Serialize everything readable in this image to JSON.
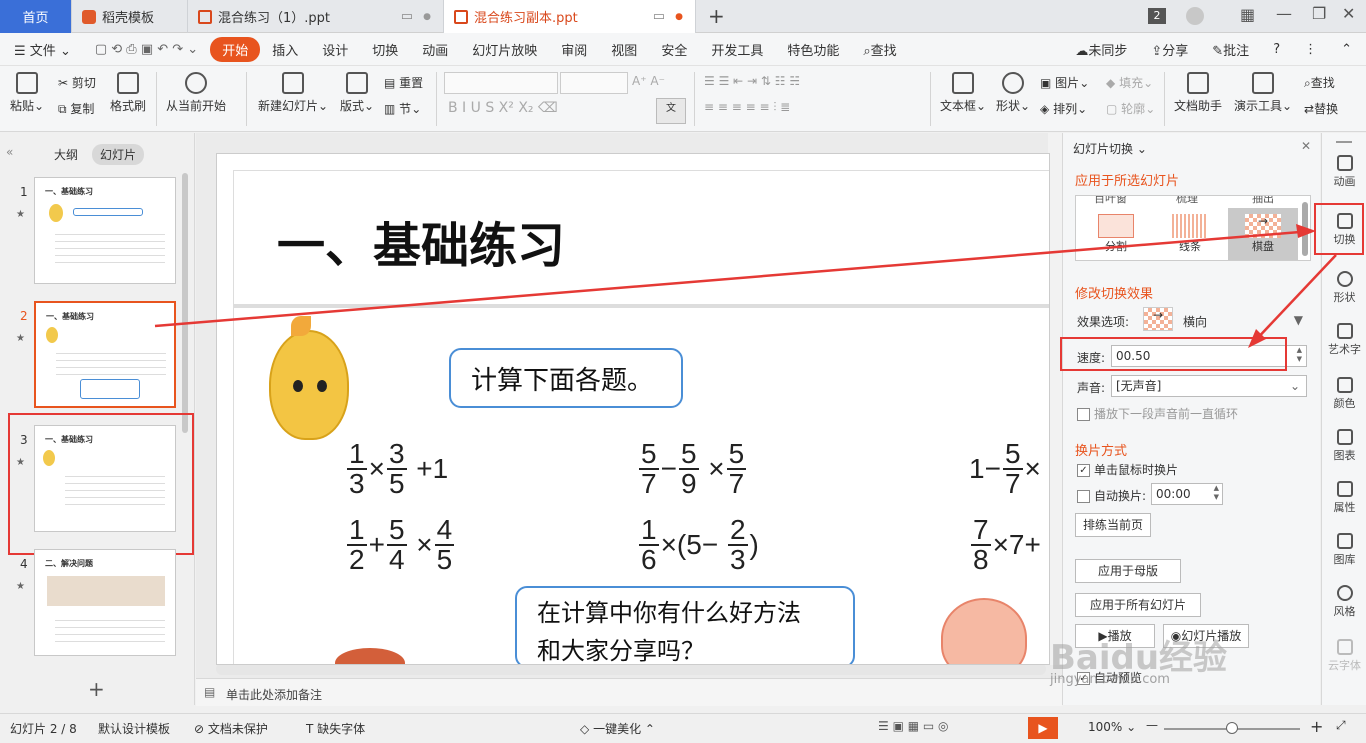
{
  "tabs": {
    "home": "首页",
    "daoke": "稻壳模板",
    "file1": "混合练习（1）.ppt",
    "file2": "混合练习副本.ppt",
    "count": "2"
  },
  "menu": {
    "file": "文件",
    "start": "开始",
    "insert": "插入",
    "design": "设计",
    "transition": "切换",
    "animation": "动画",
    "slideshow": "幻灯片放映",
    "review": "审阅",
    "view": "视图",
    "security": "安全",
    "dev": "开发工具",
    "special": "特色功能",
    "search": "查找",
    "unsync": "未同步",
    "share": "分享",
    "comment": "批注"
  },
  "ribbon": {
    "paste": "粘贴",
    "cut": "剪切",
    "copy": "复制",
    "format_brush": "格式刷",
    "from_start": "从当前开始",
    "new_slide": "新建幻灯片",
    "layout": "版式",
    "reset": "重置",
    "section": "节",
    "textbox": "文本框",
    "shape": "形状",
    "picture": "图片",
    "arrange": "排列",
    "fill": "填充",
    "outline": "轮廓",
    "doc_helper": "文档助手",
    "present_tool": "演示工具",
    "find": "查找",
    "replace": "替换"
  },
  "left": {
    "outline": "大纲",
    "slides": "幻灯片",
    "thumbs": [
      {
        "n": "1",
        "title": "一、基础练习"
      },
      {
        "n": "2",
        "title": "一、基础练习"
      },
      {
        "n": "3",
        "title": "一、基础练习"
      },
      {
        "n": "4",
        "title": "二、解决问题"
      }
    ]
  },
  "slide": {
    "title": "一、基础练习",
    "bubble1": "计算下面各题。",
    "bubble2_l1": "在计算中你有什么好方法",
    "bubble2_l2": "和大家分享吗？"
  },
  "math": {
    "r1a": "×",
    "r1b": "+1",
    "r1c": "−",
    "r1d": "×",
    "r1e": "1−",
    "r2a": "+",
    "r2b": "×",
    "r2c": "×(5−",
    "r2d": ")",
    "r2e": "×7+"
  },
  "notes": "单击此处添加备注",
  "pane": {
    "title": "幻灯片切换",
    "apply_selected": "应用于所选幻灯片",
    "effects": [
      "分割",
      "线条",
      "棋盘"
    ],
    "effects_top": [
      "百叶窗",
      "梳理",
      "抽出"
    ],
    "modify": "修改切换效果",
    "effect_option_label": "效果选项:",
    "effect_option": "横向",
    "speed_label": "速度:",
    "speed": "00.50",
    "sound_label": "声音:",
    "sound": "[无声音]",
    "loop": "播放下一段声音前一直循环",
    "mode": "换片方式",
    "on_click": "单击鼠标时换片",
    "auto": "自动换片:",
    "auto_time": "00:00",
    "rehearse": "排练当前页",
    "apply_master": "应用于母版",
    "apply_all": "应用于所有幻灯片",
    "play": "播放",
    "slideshow": "幻灯片播放",
    "auto_preview": "自动预览"
  },
  "rightbar": [
    "动画",
    "切换",
    "形状",
    "艺术字",
    "颜色",
    "图表",
    "属性",
    "图库",
    "风格",
    "云字体"
  ],
  "status": {
    "slide": "幻灯片 2 / 8",
    "template": "默认设计模板",
    "protect": "文档未保护",
    "missing_font": "缺失字体",
    "beautify": "一键美化",
    "zoom": "100%"
  },
  "watermark": {
    "brand": "Baidu经验",
    "url": "jingyan.baidu.com"
  },
  "colors": {
    "accent": "#e8541e",
    "highlight": "#e53935",
    "blue": "#3a6fd8"
  }
}
